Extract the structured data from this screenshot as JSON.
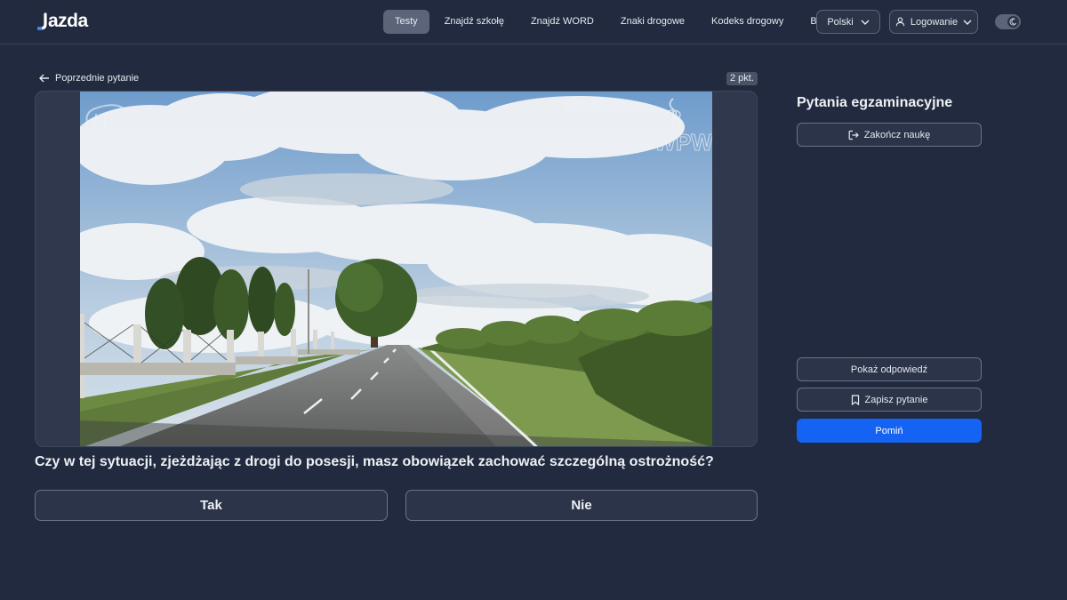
{
  "app": {
    "logo_text": "azda",
    "colors": {
      "background": "#212a3e",
      "accent": "#1463f3",
      "surface": "#2b3449"
    }
  },
  "nav": {
    "items": [
      {
        "label": "Testy",
        "active": true
      },
      {
        "label": "Znajdź szkołę",
        "active": false
      },
      {
        "label": "Znajdź WORD",
        "active": false
      },
      {
        "label": "Znaki drogowe",
        "active": false
      },
      {
        "label": "Kodeks drogowy",
        "active": false
      },
      {
        "label": "Blog",
        "active": false
      }
    ],
    "language_label": "Polski",
    "login_label": "Logowanie",
    "theme_toggle_icon": "moon-icon"
  },
  "question": {
    "prev_label": "Poprzednie pytanie",
    "points": "2 pkt.",
    "media_watermarks": [
      "ITS",
      "PWPW"
    ],
    "text": "Czy w tej sytuacji, zjeżdżając z drogi do posesji, masz obowiązek zachować szczególną ostrożność?",
    "answers": [
      "Tak",
      "Nie"
    ]
  },
  "sidebar": {
    "title": "Pytania egzaminacyjne",
    "end_label": "Zakończ naukę",
    "show_answer_label": "Pokaż odpowiedź",
    "save_label": "Zapisz pytanie",
    "skip_label": "Pomiń"
  }
}
